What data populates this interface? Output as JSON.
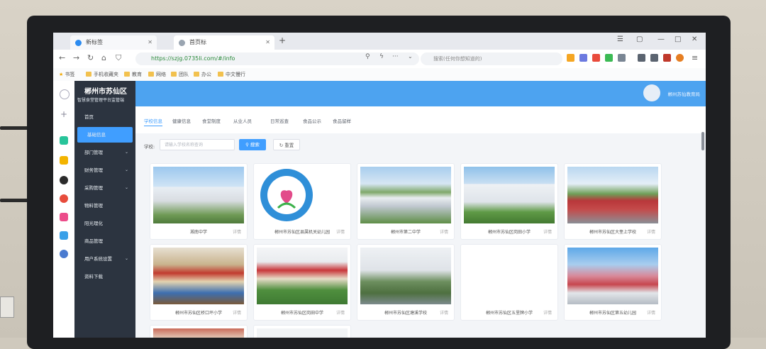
{
  "browser": {
    "tabs": [
      {
        "label": "新标签",
        "active": false
      },
      {
        "label": "首页标",
        "active": true
      }
    ],
    "url": "https://szjg.0735li.com/#/info",
    "search_placeholder": "搜索(任何你想知道的)",
    "bookmarks": [
      "书签",
      "手机收藏夹",
      "教育",
      "网络",
      "团队",
      "办公",
      "中文慢行"
    ]
  },
  "app": {
    "brand_title": "郴州市苏仙区",
    "brand_subtitle": "智慧食堂管理平台监管端",
    "user_name": "郴州苏仙教育局",
    "menu": [
      {
        "label": "首页",
        "active": false,
        "arrow": false
      },
      {
        "label": "基础信息",
        "active": true,
        "arrow": false
      },
      {
        "label": "部门管理",
        "active": false,
        "arrow": true
      },
      {
        "label": "财务管理",
        "active": false,
        "arrow": true
      },
      {
        "label": "采购管理",
        "active": false,
        "arrow": true
      },
      {
        "label": "物料管理",
        "active": false,
        "arrow": false
      },
      {
        "label": "阳光理化",
        "active": false,
        "arrow": false
      },
      {
        "label": "商品管理",
        "active": false,
        "arrow": false
      },
      {
        "label": "用户系统设置",
        "active": false,
        "arrow": true
      },
      {
        "label": "资料下载",
        "active": false,
        "arrow": false
      }
    ],
    "subtabs": [
      "学校信息",
      "健康信息",
      "食堂制度",
      "从业人员",
      "日常巡查",
      "食品公示",
      "食品留样"
    ],
    "filter": {
      "label": "学校:",
      "placeholder": "请输入学校名称查询",
      "search_button": "搜索",
      "reset_button": "重置"
    },
    "detail_label": "详情",
    "schools": [
      {
        "name": "湘南中学"
      },
      {
        "name": "郴州市苏仙区县属机关幼儿园"
      },
      {
        "name": "郴州市第二中学"
      },
      {
        "name": "郴州市苏仙区岗田小学"
      },
      {
        "name": "郴州市苏仙区大奎上学校"
      },
      {
        "name": "郴州市苏仙区桥口坪小学"
      },
      {
        "name": "郴州市苏仙区岗田中学"
      },
      {
        "name": "郴州市苏仙区塘溪学校"
      },
      {
        "name": "郴州市苏仙区五里牌小学"
      },
      {
        "name": "郴州市苏仙区第五幼儿园"
      }
    ]
  }
}
